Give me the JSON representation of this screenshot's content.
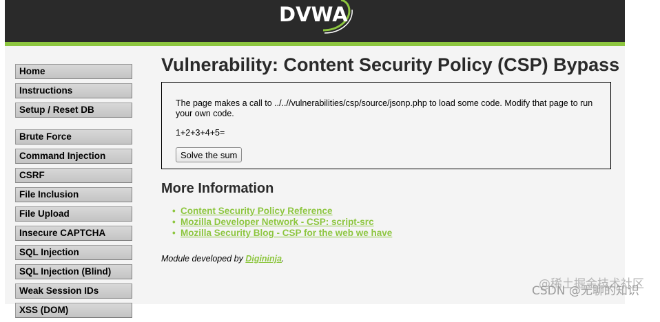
{
  "header": {
    "logo_text": "DVWA",
    "accent_color": "#8dc63f",
    "bar_color": "#2a2a2a"
  },
  "sidebar": {
    "top_items": [
      {
        "label": "Home"
      },
      {
        "label": "Instructions"
      },
      {
        "label": "Setup / Reset DB"
      }
    ],
    "vuln_items": [
      {
        "label": "Brute Force"
      },
      {
        "label": "Command Injection"
      },
      {
        "label": "CSRF"
      },
      {
        "label": "File Inclusion"
      },
      {
        "label": "File Upload"
      },
      {
        "label": "Insecure CAPTCHA"
      },
      {
        "label": "SQL Injection"
      },
      {
        "label": "SQL Injection (Blind)"
      },
      {
        "label": "Weak Session IDs"
      },
      {
        "label": "XSS (DOM)"
      }
    ]
  },
  "main": {
    "title": "Vulnerability: Content Security Policy (CSP) Bypass",
    "description": "The page makes a call to ../..//vulnerabilities/csp/source/jsonp.php to load some code. Modify that page to run your own code.",
    "sum_text": "1+2+3+4+5=",
    "solve_button_label": "Solve the sum",
    "more_info_title": "More Information",
    "links": [
      {
        "label": "Content Security Policy Reference"
      },
      {
        "label": "Mozilla Developer Network - CSP: script-src"
      },
      {
        "label": "Mozilla Security Blog - CSP for the web we have"
      }
    ],
    "credit_prefix": "Module developed by ",
    "credit_author": "Digininja",
    "credit_suffix": "."
  },
  "watermark": {
    "line1": "@稀土掘金技术社区",
    "line2": "CSDN @无聊的知识"
  }
}
